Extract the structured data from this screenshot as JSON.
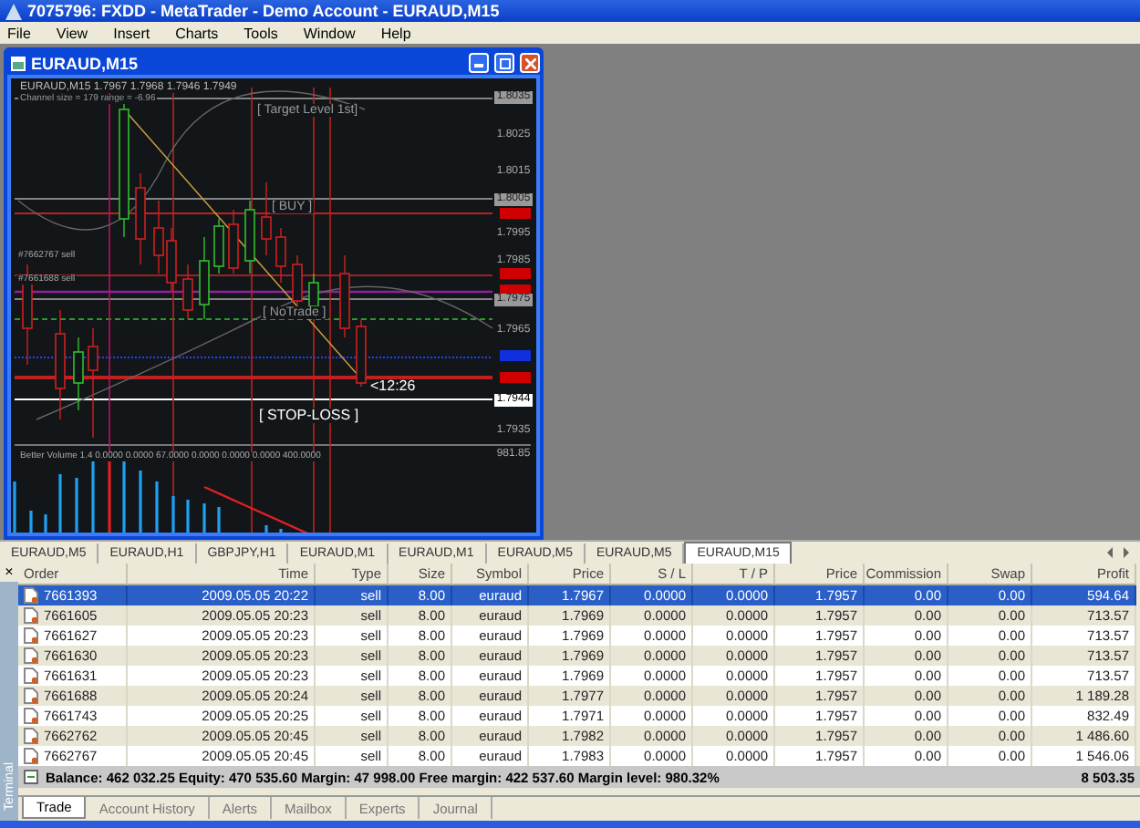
{
  "window": {
    "title": "7075796: FXDD - MetaTrader - Demo Account - EURAUD,M15"
  },
  "menu": [
    "File",
    "View",
    "Insert",
    "Charts",
    "Tools",
    "Window",
    "Help"
  ],
  "chart_window": {
    "title": "EURAUD,M15",
    "header": "EURAUD,M15  1.7967 1.7968 1.7946 1.7949",
    "subheader": "Channel size = 179 range = -6.96",
    "levels": [
      "[ Target Level 1st]",
      "[ BUY ]",
      "[ NoTrade ]",
      "[ STOP-LOSS ]"
    ],
    "order_tags": [
      "#7662767 sell",
      "#7661688 sell"
    ],
    "timer": "<12:26",
    "price_axis": [
      {
        "text": "1.8035",
        "kind": "boxed"
      },
      {
        "text": "1.8025",
        "kind": "plain"
      },
      {
        "text": "1.8015",
        "kind": "plain"
      },
      {
        "text": "1.8005",
        "kind": "boxed"
      },
      {
        "text": "1.7995",
        "kind": "plain"
      },
      {
        "text": "1.7985",
        "kind": "plain"
      },
      {
        "text": "1.7975",
        "kind": "boxed"
      },
      {
        "text": "1.7965",
        "kind": "plain"
      },
      {
        "text": "1.7944",
        "kind": "current"
      },
      {
        "text": "1.7935",
        "kind": "plain"
      }
    ],
    "indicator": "Better Volume 1.4 0.0000 0.0000 67.0000 0.0000 0.0000 0.0000 400.0000",
    "volume_axis": "981.85"
  },
  "chart_tabs": [
    {
      "label": "EURAUD,M5",
      "selected": false
    },
    {
      "label": "EURAUD,H1",
      "selected": false
    },
    {
      "label": "GBPJPY,H1",
      "selected": false
    },
    {
      "label": "EURAUD,M1",
      "selected": false
    },
    {
      "label": "EURAUD,M1",
      "selected": false
    },
    {
      "label": "EURAUD,M5",
      "selected": false
    },
    {
      "label": "EURAUD,M5",
      "selected": false
    },
    {
      "label": "EURAUD,M15",
      "selected": true
    }
  ],
  "terminal": {
    "label": "Terminal",
    "close": "×",
    "columns": [
      "Order",
      "Time",
      "Type",
      "Size",
      "Symbol",
      "Price",
      "S / L",
      "T / P",
      "Price",
      "Commission",
      "Swap",
      "Profit"
    ],
    "rows": [
      {
        "selected": true,
        "cells": [
          "7661393",
          "2009.05.05 20:22",
          "sell",
          "8.00",
          "euraud",
          "1.7967",
          "0.0000",
          "0.0000",
          "1.7957",
          "0.00",
          "0.00",
          "594.64"
        ]
      },
      {
        "selected": false,
        "cells": [
          "7661605",
          "2009.05.05 20:23",
          "sell",
          "8.00",
          "euraud",
          "1.7969",
          "0.0000",
          "0.0000",
          "1.7957",
          "0.00",
          "0.00",
          "713.57"
        ]
      },
      {
        "selected": false,
        "cells": [
          "7661627",
          "2009.05.05 20:23",
          "sell",
          "8.00",
          "euraud",
          "1.7969",
          "0.0000",
          "0.0000",
          "1.7957",
          "0.00",
          "0.00",
          "713.57"
        ]
      },
      {
        "selected": false,
        "cells": [
          "7661630",
          "2009.05.05 20:23",
          "sell",
          "8.00",
          "euraud",
          "1.7969",
          "0.0000",
          "0.0000",
          "1.7957",
          "0.00",
          "0.00",
          "713.57"
        ]
      },
      {
        "selected": false,
        "cells": [
          "7661631",
          "2009.05.05 20:23",
          "sell",
          "8.00",
          "euraud",
          "1.7969",
          "0.0000",
          "0.0000",
          "1.7957",
          "0.00",
          "0.00",
          "713.57"
        ]
      },
      {
        "selected": false,
        "cells": [
          "7661688",
          "2009.05.05 20:24",
          "sell",
          "8.00",
          "euraud",
          "1.7977",
          "0.0000",
          "0.0000",
          "1.7957",
          "0.00",
          "0.00",
          "1 189.28"
        ]
      },
      {
        "selected": false,
        "cells": [
          "7661743",
          "2009.05.05 20:25",
          "sell",
          "8.00",
          "euraud",
          "1.7971",
          "0.0000",
          "0.0000",
          "1.7957",
          "0.00",
          "0.00",
          "832.49"
        ]
      },
      {
        "selected": false,
        "cells": [
          "7662762",
          "2009.05.05 20:45",
          "sell",
          "8.00",
          "euraud",
          "1.7982",
          "0.0000",
          "0.0000",
          "1.7957",
          "0.00",
          "0.00",
          "1 486.60"
        ]
      },
      {
        "selected": false,
        "cells": [
          "7662767",
          "2009.05.05 20:45",
          "sell",
          "8.00",
          "euraud",
          "1.7983",
          "0.0000",
          "0.0000",
          "1.7957",
          "0.00",
          "0.00",
          "1 546.06"
        ]
      }
    ],
    "summary": "Balance: 462 032.25  Equity: 470 535.60  Margin: 47 998.00  Free margin: 422 537.60  Margin level: 980.32%",
    "total": "8 503.35",
    "tabs": [
      {
        "label": "Trade",
        "selected": true
      },
      {
        "label": "Account History",
        "selected": false
      },
      {
        "label": "Alerts",
        "selected": false
      },
      {
        "label": "Mailbox",
        "selected": false
      },
      {
        "label": "Experts",
        "selected": false
      },
      {
        "label": "Journal",
        "selected": false
      }
    ]
  }
}
